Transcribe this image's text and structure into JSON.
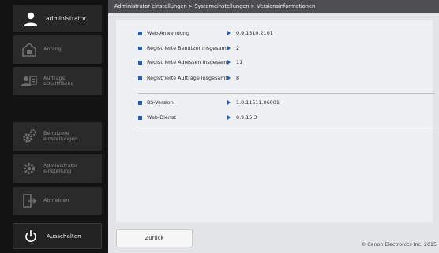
{
  "sidebar": {
    "user": {
      "name": "administrator",
      "icon": "user-icon"
    },
    "items": [
      {
        "label": "Anfang",
        "icon": "home-icon"
      },
      {
        "label_line1": "Auftrags",
        "label_line2": "schaltfläche",
        "icon": "job-users-icon"
      },
      {
        "label": "Benutzere einstellungen",
        "icon": "user-settings-gear-icon"
      },
      {
        "label_line1": "Administrator",
        "label_line2": "einstellung",
        "icon": "admin-gear-icon"
      },
      {
        "label": "Abmelden",
        "icon": "logout-icon"
      }
    ],
    "power": {
      "label": "Ausschalten",
      "icon": "power-icon"
    }
  },
  "breadcrumb": "Administrator einstellungen > Systemeinstellungen > Versionsinformationen",
  "info_group1": [
    {
      "label": "Web-Anwendung",
      "value": "0.9.1510.2101"
    },
    {
      "label": "Registrierte Benutzer insgesamt",
      "value": "2"
    },
    {
      "label": "Registrierte Adressen insgesamt",
      "value": "11"
    },
    {
      "label": "Registrierte Aufträge insgesamt",
      "value": "8"
    }
  ],
  "info_group2": [
    {
      "label": "BS-Version",
      "value": "1.0.11511.06001"
    },
    {
      "label": "Web-Dienst",
      "value": "0.9.15.3"
    }
  ],
  "footer": {
    "back_label": "Zurück",
    "copyright": "© Canon Electronics Inc. 2015"
  },
  "colors": {
    "accent": "#1f5fbf",
    "sidebar_bg": "#131313",
    "breadcrumb_bg": "#4e4e50",
    "content_bg": "#e3e4e6"
  }
}
